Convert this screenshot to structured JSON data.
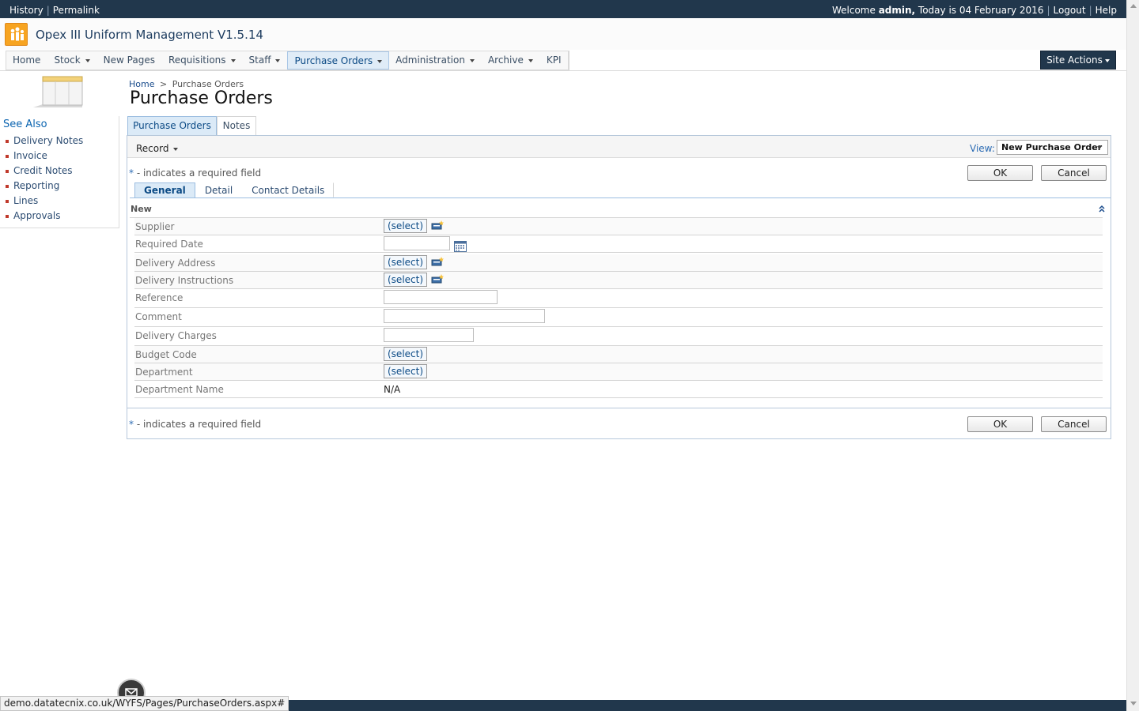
{
  "topbar": {
    "history": "History",
    "permalink": "Permalink",
    "welcome_prefix": "Welcome",
    "user": "admin,",
    "today": "Today is 04 February 2016",
    "logout": "Logout",
    "help": "Help"
  },
  "header": {
    "app_title": "Opex III Uniform Management V1.5.14",
    "logo_icon": "people-logo-icon"
  },
  "nav": {
    "items": [
      {
        "label": "Home",
        "dropdown": false
      },
      {
        "label": "Stock",
        "dropdown": true
      },
      {
        "label": "New Pages",
        "dropdown": false
      },
      {
        "label": "Requisitions",
        "dropdown": true
      },
      {
        "label": "Staff",
        "dropdown": true
      },
      {
        "label": "Purchase Orders",
        "dropdown": true,
        "active": true
      },
      {
        "label": "Administration",
        "dropdown": true
      },
      {
        "label": "Archive",
        "dropdown": true
      },
      {
        "label": "KPI",
        "dropdown": false
      }
    ],
    "site_actions": "Site Actions"
  },
  "breadcrumb": {
    "home": "Home",
    "separator": ">",
    "current": "Purchase Orders"
  },
  "page_title": "Purchase Orders",
  "sidebar": {
    "heading": "See Also",
    "links": [
      "Delivery Notes",
      "Invoice",
      "Credit Notes",
      "Reporting",
      "Lines",
      "Approvals"
    ]
  },
  "tabs": {
    "purchase_orders": "Purchase Orders",
    "notes": "Notes"
  },
  "toolbar": {
    "record": "Record",
    "view_label": "View:",
    "view_value": "New Purchase Order"
  },
  "form": {
    "required_star": "*",
    "required_note": "- indicates a required field",
    "ok": "OK",
    "cancel": "Cancel",
    "inner_tabs": [
      "General",
      "Detail",
      "Contact Details"
    ],
    "section_title": "New",
    "select_label": "(select)",
    "fields": {
      "supplier": "Supplier",
      "required_date": "Required Date",
      "delivery_address": "Delivery Address",
      "delivery_instructions": "Delivery Instructions",
      "reference": "Reference",
      "comment": "Comment",
      "delivery_charges": "Delivery Charges",
      "budget_code": "Budget Code",
      "department": "Department",
      "department_name": "Department Name"
    },
    "department_name_value": "N/A",
    "reference_value": "",
    "comment_value": "",
    "delivery_charges_value": "",
    "required_date_value": ""
  },
  "status_bar": {
    "url": "demo.datatecnix.co.uk/WYFS/Pages/PurchaseOrders.aspx#"
  },
  "colors": {
    "top_bar": "#21374c",
    "active_tab": "#dbeaf7",
    "logo": "#f7a421",
    "link": "#0b4a85"
  }
}
